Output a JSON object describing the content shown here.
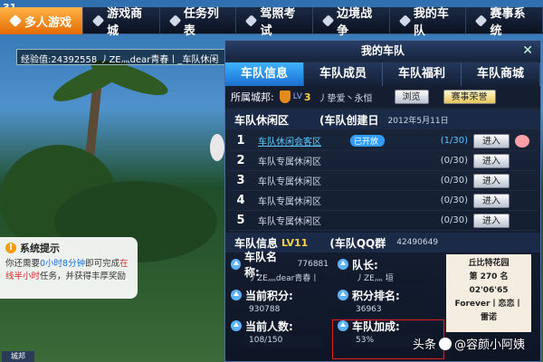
{
  "corner_number": "31",
  "topbar": {
    "tabs": [
      {
        "label": "多人游戏",
        "active": true
      },
      {
        "label": "游戏商城",
        "active": false
      },
      {
        "label": "任务列表",
        "active": false
      },
      {
        "label": "驾照考试",
        "active": false
      },
      {
        "label": "边境战争",
        "active": false
      },
      {
        "label": "我的车队",
        "active": false
      },
      {
        "label": "赛事系统",
        "active": false
      }
    ]
  },
  "exp": {
    "text": "经验值:24392558 丿ZE灬dear青春丨_车队休闲"
  },
  "tip": {
    "title": "系统提示",
    "line1_pre": "你还需要",
    "line1_hl": "0小时8分钟",
    "line1_post": "即可完成",
    "line1_end": "在",
    "line2_hl": "线半小时",
    "line2_post": "任务，并获得丰厚奖励"
  },
  "bottom_chip": "城邦",
  "window": {
    "title": "我的车队",
    "close": "✕",
    "tabs": [
      "车队信息",
      "车队成员",
      "车队福利",
      "车队商城"
    ],
    "city": {
      "label": "所属城邦:",
      "lv_prefix": "LV",
      "level": "3",
      "name": "丿挚爱丶永恒",
      "browse_btn": "浏览",
      "honor_btn": "赛事荣誉"
    },
    "lounge": {
      "title": "车队休闲区",
      "created_label": "(车队创建日",
      "created_date": "2012年5月11日",
      "rows": [
        {
          "num": "1",
          "name": "车队休闲会客区",
          "status": "已开放",
          "count": "(1/30)",
          "btn": "进入"
        },
        {
          "num": "2",
          "name": "车队专属休闲区",
          "count": "(0/30)",
          "btn": "进入"
        },
        {
          "num": "3",
          "name": "车队专属休闲区",
          "count": "(0/30)",
          "btn": "进入"
        },
        {
          "num": "4",
          "name": "车队专属休闲区",
          "count": "(0/30)",
          "btn": "进入"
        },
        {
          "num": "5",
          "name": "车队专属休闲区",
          "count": "(0/30)",
          "btn": "进入"
        }
      ]
    },
    "info": {
      "title": "车队信息",
      "level": "LV11",
      "qq_label": "(车队QQ群",
      "qq_value": "42490649",
      "team_name_label": "车队名称:",
      "team_id": "776881",
      "team_name": "丿ZE灬dear青春丨",
      "captain_label": "队长:",
      "captain": "丿ZE灬    垣",
      "points_label": "当前积分:",
      "points": "930788",
      "rank_label": "积分排名:",
      "rank": "36963",
      "members_label": "当前人数:",
      "members": "108/150",
      "bonus_label": "车队加成:",
      "bonus": "53%"
    },
    "card": {
      "line1": "丘比特花园",
      "line2": "第 270 名",
      "line3": "02'06'65",
      "line4": "Forever丨恋恋丨",
      "line5": "雷诺"
    }
  },
  "watermark": {
    "pre": "头条",
    "post": "@容颜小阿姨"
  }
}
